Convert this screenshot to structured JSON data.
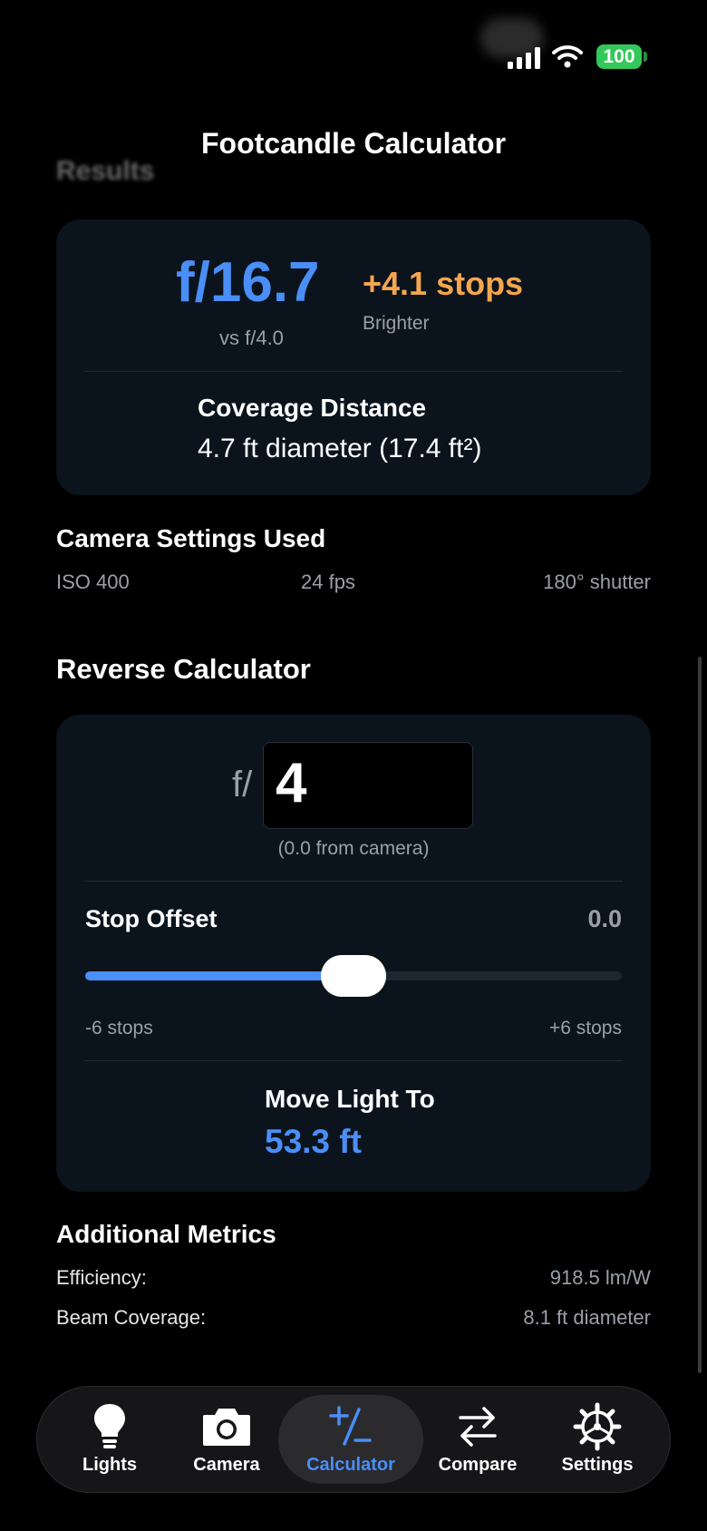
{
  "status": {
    "battery": "100"
  },
  "header": {
    "title": "Footcandle Calculator",
    "ghost_heading": "Results"
  },
  "result": {
    "f_value": "f/16.7",
    "vs_text": "vs f/4.0",
    "stops": "+4.1 stops",
    "stops_caption": "Brighter",
    "coverage_label": "Coverage Distance",
    "coverage_value": "4.7 ft diameter (17.4 ft²)"
  },
  "camera_settings": {
    "heading": "Camera Settings Used",
    "iso": "ISO 400",
    "fps": "24 fps",
    "shutter": "180° shutter"
  },
  "reverse": {
    "heading": "Reverse Calculator",
    "f_prefix": "f/",
    "f_input_value": "4",
    "from_camera": "(0.0 from camera)",
    "offset_label": "Stop Offset",
    "offset_value": "0.0",
    "slider_fraction": 0.5,
    "min_label": "-6 stops",
    "max_label": "+6 stops",
    "move_label": "Move Light To",
    "move_value": "53.3 ft"
  },
  "metrics": {
    "heading": "Additional Metrics",
    "efficiency_label": "Efficiency:",
    "efficiency_value": "918.5 lm/W",
    "beam_label": "Beam Coverage:",
    "beam_value": "8.1 ft diameter"
  },
  "tabs": [
    {
      "label": "Lights",
      "icon": "lightbulb-icon"
    },
    {
      "label": "Camera",
      "icon": "camera-icon"
    },
    {
      "label": "Calculator",
      "icon": "plus-minus-icon",
      "active": true
    },
    {
      "label": "Compare",
      "icon": "arrows-swap-icon"
    },
    {
      "label": "Settings",
      "icon": "gear-icon"
    }
  ],
  "colors": {
    "accent": "#4a8ef7",
    "positive_stops": "#f4a64e",
    "card": "#0b131c",
    "battery": "#34c759"
  }
}
